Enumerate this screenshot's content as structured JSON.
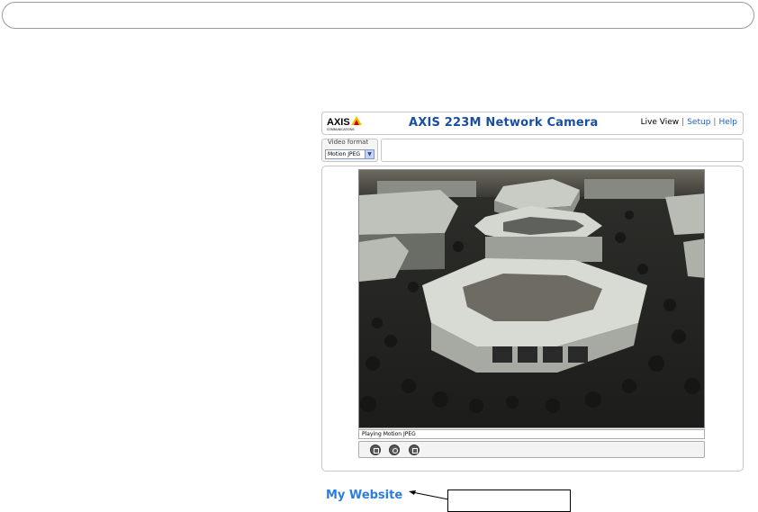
{
  "header": {
    "logo_text": "AXIS",
    "logo_subtext": "COMMUNICATIONS",
    "title": "AXIS 223M Network Camera",
    "nav": {
      "live_view": "Live View",
      "separator": "|",
      "setup": "Setup",
      "help": "Help"
    }
  },
  "video_format": {
    "label": "Video format",
    "selected": "Motion JPEG"
  },
  "video": {
    "status": "Playing Motion JPEG"
  },
  "controls": [
    {
      "icon": "stop-icon"
    },
    {
      "icon": "snapshot-icon"
    },
    {
      "icon": "view-full-size-icon"
    }
  ],
  "footer": {
    "my_website": "My Website"
  },
  "colors": {
    "title_blue": "#1a4fa0",
    "link_blue": "#1a5fc8",
    "website_blue": "#2a7de1",
    "logo_yellow": "#f4c300"
  }
}
